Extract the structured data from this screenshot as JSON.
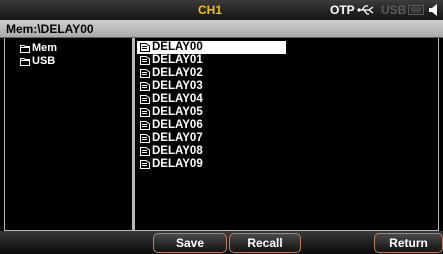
{
  "status_bar": {
    "channel": "CH1",
    "otp": "OTP",
    "usb_label": "USB",
    "icons": [
      "usb-plug-icon",
      "display-dim-icon",
      "beeper-icon"
    ]
  },
  "path_bar": {
    "path": "Mem:\\DELAY00"
  },
  "tree": [
    {
      "label": "Mem",
      "icon": "folder-icon"
    },
    {
      "label": "USB",
      "icon": "folder-icon"
    }
  ],
  "files": [
    {
      "label": "DELAY00",
      "selected": true
    },
    {
      "label": "DELAY01"
    },
    {
      "label": "DELAY02"
    },
    {
      "label": "DELAY03"
    },
    {
      "label": "DELAY04"
    },
    {
      "label": "DELAY05"
    },
    {
      "label": "DELAY06"
    },
    {
      "label": "DELAY07"
    },
    {
      "label": "DELAY08"
    },
    {
      "label": "DELAY09"
    }
  ],
  "softkeys": {
    "save": "Save",
    "recall": "Recall",
    "return": "Return"
  },
  "colors": {
    "channel": "#f2c200",
    "softkey_border": "#c07c58",
    "selection": "#ffffff"
  }
}
